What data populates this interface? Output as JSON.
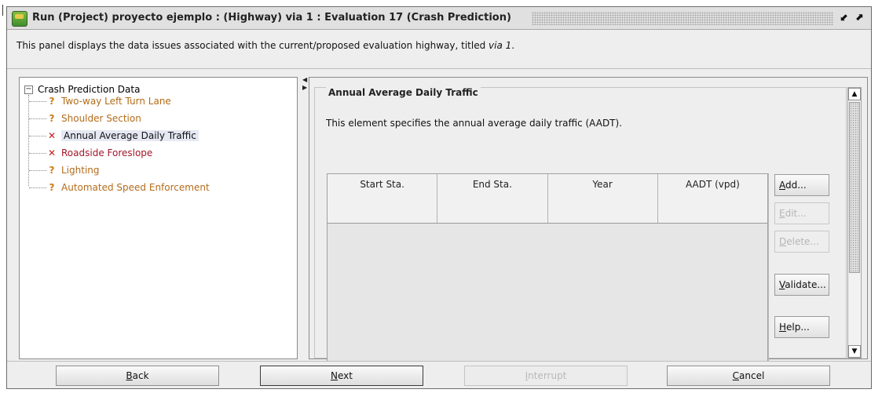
{
  "window": {
    "title": "Run (Project) proyecto ejemplo : (Highway) via 1 : Evaluation 17 (Crash Prediction)",
    "restore_glyph": "⬋",
    "maximize_glyph": "⬈"
  },
  "description": {
    "prefix": "This panel displays the data issues associated with the current/proposed evaluation highway, titled ",
    "highway": "via 1",
    "suffix": "."
  },
  "tree": {
    "toggle": "−",
    "root": "Crash Prediction Data",
    "items": [
      {
        "label": "Two-way Left Turn Lane",
        "status": "warning",
        "icon": "question-icon",
        "glyph": "?"
      },
      {
        "label": "Shoulder Section",
        "status": "warning",
        "icon": "question-icon",
        "glyph": "?"
      },
      {
        "label": "Annual Average Daily Traffic",
        "status": "error",
        "icon": "x-icon",
        "glyph": "✕"
      },
      {
        "label": "Roadside Foreslope",
        "status": "error",
        "icon": "x-icon",
        "glyph": "✕"
      },
      {
        "label": "Lighting",
        "status": "warning",
        "icon": "question-icon",
        "glyph": "?"
      },
      {
        "label": "Automated Speed Enforcement",
        "status": "warning",
        "icon": "question-icon",
        "glyph": "?"
      }
    ],
    "selected": "Annual Average Daily Traffic"
  },
  "element": {
    "title": "Annual Average Daily Traffic",
    "description": "This element specifies the annual average daily traffic (AADT).",
    "columns": [
      "Start Sta.",
      "End Sta.",
      "Year",
      "AADT (vpd)"
    ],
    "rows": []
  },
  "side_buttons": {
    "add": {
      "u": "A",
      "rest": "dd...",
      "enabled": true
    },
    "edit": {
      "u": "E",
      "rest": "dit...",
      "enabled": false
    },
    "delete": {
      "u": "D",
      "rest": "elete...",
      "enabled": false
    },
    "validate": {
      "u": "V",
      "rest": "alidate...",
      "enabled": true
    },
    "help": {
      "u": "H",
      "rest": "elp...",
      "enabled": true
    }
  },
  "scroll": {
    "up": "▲",
    "down": "▼"
  },
  "nav_buttons": {
    "back": {
      "u": "B",
      "rest": "ack",
      "enabled": true
    },
    "next": {
      "u": "N",
      "rest": "ext",
      "enabled": true
    },
    "interrupt": {
      "u": "I",
      "rest": "nterrupt",
      "enabled": false
    },
    "cancel": {
      "u": "C",
      "rest": "ancel",
      "enabled": true
    }
  },
  "colors": {
    "warning_text": "#b36c1a",
    "error_text": "#a4162a",
    "warning_icon": "#d07a18",
    "error_icon": "#cc1b1b"
  }
}
